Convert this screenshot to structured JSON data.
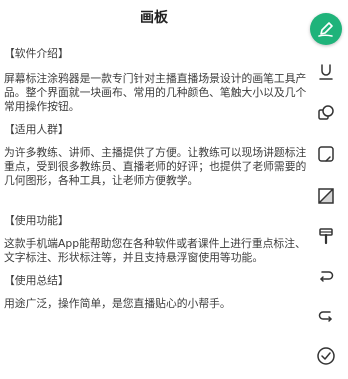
{
  "title": "画板",
  "sections": [
    {
      "heading": "【软件介绍】",
      "body": "屏幕标注涂鸦器是一款专门针对主播直播场景设计的画笔工具产品。整个界面就一块画布、常用的几种颜色、笔触大小以及几个常用操作按钮。"
    },
    {
      "heading": "【适用人群】",
      "body": "为许多教练、讲师、主播提供了方便。让教练可以现场讲题标注重点，受到很多教练员、直播老师的好评；也提供了老师需要的几何图形，各种工具，让老师方便教学。"
    },
    {
      "heading": "【使用功能】",
      "body": "这款手机端App能帮助您在各种软件或者课件上进行重点标注、文字标注、形状标注等，并且支持悬浮窗使用等功能。"
    },
    {
      "heading": "【使用总结】",
      "body": "用途广泛，操作简单，是您直播贴心的小帮手。"
    }
  ],
  "toolbar": {
    "accent": "#1fb37a",
    "tools": [
      {
        "icon": "pen-icon",
        "active": true
      },
      {
        "icon": "underline-icon",
        "active": false
      },
      {
        "icon": "shape-icon",
        "active": false
      },
      {
        "icon": "rectangle-icon",
        "active": false
      },
      {
        "icon": "eraser-icon",
        "active": false
      },
      {
        "icon": "paint-roller-icon",
        "active": false
      },
      {
        "icon": "undo-icon",
        "active": false
      },
      {
        "icon": "redo-icon",
        "active": false
      },
      {
        "icon": "confirm-check-icon",
        "active": false
      }
    ]
  }
}
